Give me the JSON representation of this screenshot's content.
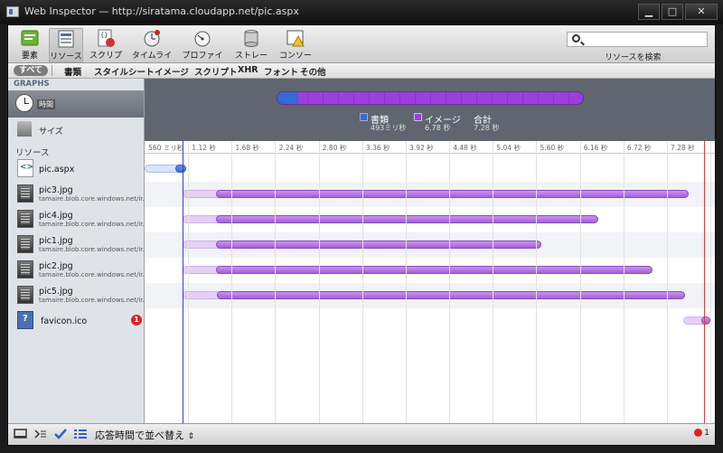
{
  "window": {
    "title": "Web Inspector — http://siratama.cloudapp.net/pic.aspx",
    "minimize": "▁",
    "maximize": "□",
    "close": "✕"
  },
  "toolbar": {
    "items": [
      {
        "label": "要素",
        "icon": "elements-icon"
      },
      {
        "label": "リソース",
        "icon": "resources-icon"
      },
      {
        "label": "スクリプト",
        "icon": "scripts-icon"
      },
      {
        "label": "タイムライン",
        "icon": "timeline-icon"
      },
      {
        "label": "プロファイル",
        "icon": "profiles-icon"
      },
      {
        "label": "ストレージ",
        "icon": "storage-icon"
      },
      {
        "label": "コンソール",
        "icon": "console-icon"
      }
    ],
    "search_placeholder": "",
    "search_label": "リソースを検索"
  },
  "filters": [
    "すべて",
    "書類",
    "スタイルシート",
    "イメージ",
    "スクリプト",
    "XHR",
    "フォント",
    "その他"
  ],
  "sidebar": {
    "graphs_header": "GRAPHS",
    "time_label": "時間",
    "size_label": "サイズ",
    "resources_header": "リソース",
    "resources": [
      {
        "name": "pic.aspx",
        "sub": "",
        "type": "html"
      },
      {
        "name": "pic3.jpg",
        "sub": "tamaire.blob.core.windows.net/ir...",
        "type": "img"
      },
      {
        "name": "pic4.jpg",
        "sub": "tamaire.blob.core.windows.net/ir...",
        "type": "img"
      },
      {
        "name": "pic1.jpg",
        "sub": "tamaire.blob.core.windows.net/ir...",
        "type": "img"
      },
      {
        "name": "pic2.jpg",
        "sub": "tamaire.blob.core.windows.net/ir...",
        "type": "img"
      },
      {
        "name": "pic5.jpg",
        "sub": "tamaire.blob.core.windows.net/ir...",
        "type": "img"
      },
      {
        "name": "favicon.ico",
        "sub": "",
        "type": "ico",
        "errors": "1"
      }
    ]
  },
  "summary": {
    "legend": [
      {
        "name": "書類",
        "value": "493ミリ秒",
        "color": "#3569d6"
      },
      {
        "name": "イメージ",
        "value": "6.78 秒",
        "color": "#9a3fdc"
      },
      {
        "name": "合計",
        "value": "7.28 秒",
        "color": ""
      }
    ],
    "document_fraction": 0.068
  },
  "ruler": [
    "560 ミリ秒",
    "1.12 秒",
    "1.68 秒",
    "2.24 秒",
    "2.80 秒",
    "3.36 秒",
    "3.92 秒",
    "4.48 秒",
    "5.04 秒",
    "5.60 秒",
    "6.16 秒",
    "6.72 秒",
    "7.28 秒"
  ],
  "timeline": {
    "total_seconds": 7.28,
    "dom_content_loaded": 0.493,
    "load": 7.2,
    "requests": [
      {
        "kind": "doc",
        "start": 0.0,
        "response": 0.39,
        "end": 0.54
      },
      {
        "kind": "img",
        "start": 0.49,
        "response": 0.92,
        "end": 7.0
      },
      {
        "kind": "img",
        "start": 0.49,
        "response": 0.92,
        "end": 5.84
      },
      {
        "kind": "img",
        "start": 0.49,
        "response": 0.92,
        "end": 5.11
      },
      {
        "kind": "img",
        "start": 0.49,
        "response": 0.92,
        "end": 6.53
      },
      {
        "kind": "img",
        "start": 0.49,
        "response": 0.93,
        "end": 6.96
      },
      {
        "kind": "img",
        "start": 6.93,
        "response": 7.16,
        "end": 7.28
      }
    ]
  },
  "statusbar": {
    "sort_label": "応答時間で並べ替え",
    "sort_arrow": "⇕",
    "error_count": "1"
  }
}
